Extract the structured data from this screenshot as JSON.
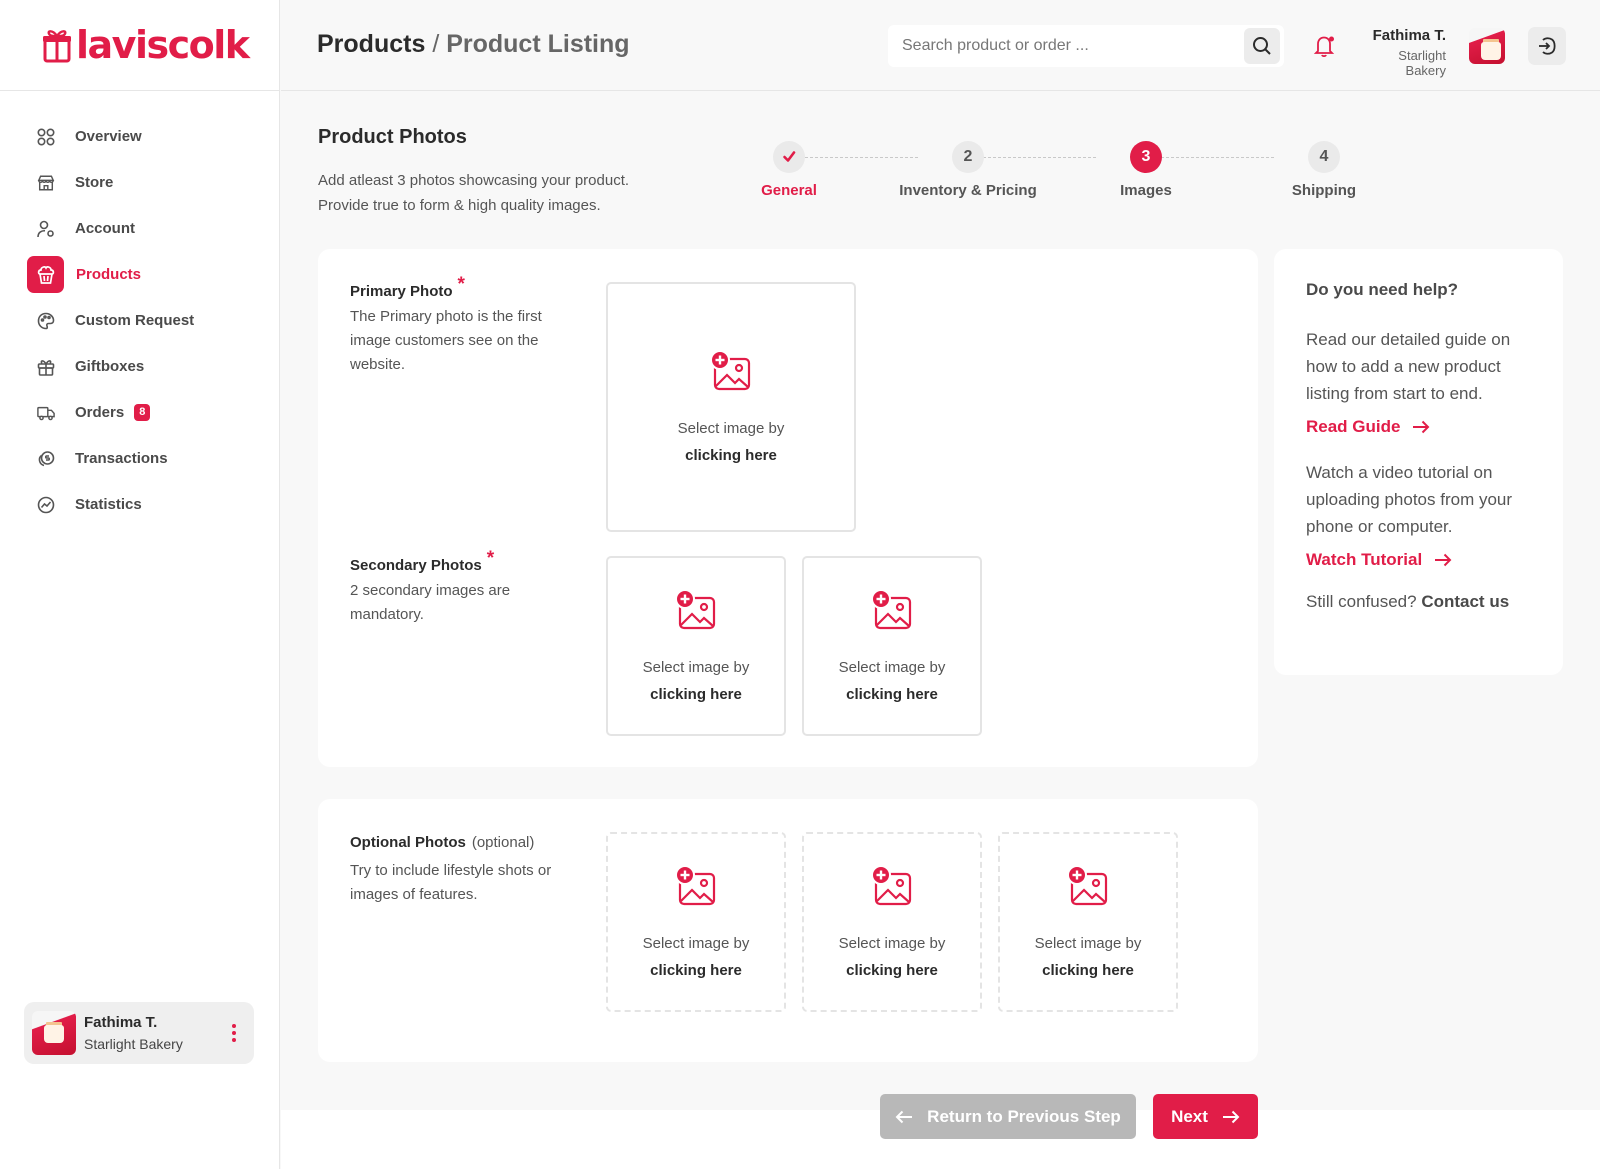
{
  "brand": {
    "name": "laviscolk",
    "accent": "#e11d48"
  },
  "sidebar": {
    "items": [
      {
        "label": "Overview",
        "icon": "grid-icon"
      },
      {
        "label": "Store",
        "icon": "store-icon"
      },
      {
        "label": "Account",
        "icon": "user-gear-icon"
      },
      {
        "label": "Products",
        "icon": "cupcake-icon",
        "active": true
      },
      {
        "label": "Custom Request",
        "icon": "palette-icon"
      },
      {
        "label": "Giftboxes",
        "icon": "gift-icon"
      },
      {
        "label": "Orders",
        "icon": "truck-icon",
        "badge": "8"
      },
      {
        "label": "Transactions",
        "icon": "coins-icon"
      },
      {
        "label": "Statistics",
        "icon": "chart-icon"
      }
    ],
    "user": {
      "name": "Fathima T.",
      "store": "Starlight Bakery"
    }
  },
  "header": {
    "title": "Products",
    "separator": "/",
    "subtitle": "Product Listing",
    "search_placeholder": "Search product or order ...",
    "user_name": "Fathima T.",
    "user_store": "Starlight Bakery"
  },
  "section": {
    "title": "Product Photos",
    "desc_line1": "Add atleast 3 photos showcasing your product.",
    "desc_line2": "Provide true to form & high quality images."
  },
  "stepper": {
    "steps": [
      {
        "number": "1",
        "label": "General",
        "state": "done"
      },
      {
        "number": "2",
        "label": "Inventory & Pricing",
        "state": "pending"
      },
      {
        "number": "3",
        "label": "Images",
        "state": "current"
      },
      {
        "number": "4",
        "label": "Shipping",
        "state": "pending"
      }
    ]
  },
  "primary": {
    "label": "Primary Photo",
    "required_mark": "*",
    "desc1": "The Primary photo is the first",
    "desc2": "image customers see on the",
    "desc3": "website."
  },
  "secondary": {
    "label": "Secondary Photos",
    "required_mark": "*",
    "desc1": "2 secondary images are",
    "desc2": "mandatory."
  },
  "optional": {
    "label": "Optional Photos",
    "note": "(optional)",
    "desc1": "Try to include lifestyle shots or",
    "desc2": "images of features."
  },
  "upload": {
    "line1": "Select image by",
    "line2": "clicking here"
  },
  "help": {
    "title": "Do you need help?",
    "guide_text": "Read our detailed guide on how to add a new product listing from start to end.",
    "guide_link": "Read Guide",
    "video_text": "Watch a video tutorial on uploading photos from your phone or computer.",
    "video_link": "Watch Tutorial",
    "confused": "Still confused?",
    "contact": "Contact us"
  },
  "footer": {
    "prev_label": "Return to Previous Step",
    "next_label": "Next"
  }
}
